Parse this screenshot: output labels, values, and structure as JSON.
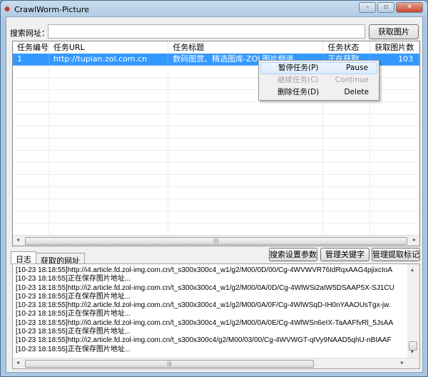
{
  "window": {
    "title": "CrawlWorm-Picture",
    "minimize": "–",
    "maximize": "▫",
    "close": "✕"
  },
  "search": {
    "label": "搜索网址：",
    "value": "",
    "placeholder": "",
    "button": "获取图片"
  },
  "table": {
    "headers": [
      "任务编号",
      "任务URL",
      "任务标题",
      "任务状态",
      "获取图片数"
    ],
    "rows": [
      {
        "id": "1",
        "url": "http://tupian.zol.com.cn",
        "title": "数码图赏、精选图库-ZOL图片频道",
        "status": "正在获取",
        "count": "103",
        "selected": true
      }
    ]
  },
  "context_menu": [
    {
      "label": "暂停任务(P)",
      "en": "Pause",
      "state": "highlighted"
    },
    {
      "label": "继续任务(C)",
      "en": "Continue",
      "state": "disabled"
    },
    {
      "label": "删除任务(D)",
      "en": "Delete",
      "state": "normal"
    }
  ],
  "tabs": [
    {
      "label": "日志",
      "active": true
    },
    {
      "label": "获取的网址",
      "active": false
    }
  ],
  "buttons": {
    "search_settings": "搜索设置参数",
    "manage_keywords": "管理关键字",
    "manage_marks": "管理提取标记"
  },
  "log": [
    "[10-23 18:18:55]http://i4.article.fd.zol-img.com.cn/t_s300x300c4_w1/g2/M00/0D/00/Cg-4WVWVR76IdRqxAAG4pjixcIoA",
    "[10-23 18:18:55]正在保存图片地址...",
    "[10-23 18:18:55]http://i2.article.fd.zol-img.com.cn/t_s300x300c4_w1/g2/M00/0A/0D/Cg-4WlWSi2aIW5DSAAP5X-SJ1CU",
    "[10-23 18:18:55]正在保存图片地址...",
    "[10-23 18:18:55]http://i2.article.fd.zol-img.com.cn/t_s300x300c4_w1/g2/M00/0A/0F/Cg-4WlWSqD-IH0nYAAOUsTgx-jw.",
    "[10-23 18:18:55]正在保存图片地址...",
    "[10-23 18:18:55]http://i0.article.fd.zol-img.com.cn/t_s300x300c4_w1/g2/M00/0A/0E/Cg-4WlWSn6eIX-TaAAFfvRl_5JsAA",
    "[10-23 18:18:55]正在保存图片地址...",
    "[10-23 18:18:55]http://i2.article.fd.zol-img.com.cn/t_s300x300c4/g2/M00/03/00/Cg-4WVWGT-qIVy9NAAD5qhU-nBIAAF",
    "[10-23 18:18:55]正在保存图片地址..."
  ],
  "colors": {
    "selection": "#3399ff",
    "window_bg": "#f0f0f0"
  }
}
